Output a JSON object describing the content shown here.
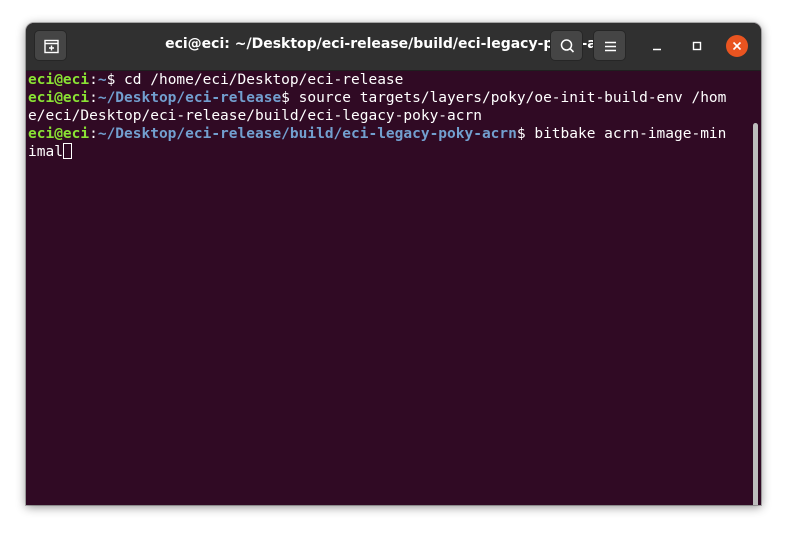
{
  "window": {
    "title": "eci@eci: ~/Desktop/eci-release/build/eci-legacy-poky-acrn"
  },
  "toolbar": {
    "new_tab_icon": "new-tab-icon",
    "search_icon": "search-icon",
    "menu_icon": "hamburger-menu-icon",
    "minimize_icon": "minimize-icon",
    "maximize_icon": "maximize-icon",
    "close_icon": "close-icon"
  },
  "colors": {
    "terminal_bg": "#300a24",
    "prompt_user": "#8ae234",
    "prompt_path": "#729fcf",
    "close_button": "#e95420"
  },
  "terminal": {
    "lines": [
      {
        "user": "eci@eci",
        "sep": ":",
        "path": "~",
        "symbol": "$",
        "command": " cd /home/eci/Desktop/eci-release"
      },
      {
        "user": "eci@eci",
        "sep": ":",
        "path": "~/Desktop/eci-release",
        "symbol": "$",
        "command": " source targets/layers/poky/oe-init-build-env /hom"
      },
      {
        "text": "e/eci/Desktop/eci-release/build/eci-legacy-poky-acrn"
      },
      {
        "user": "eci@eci",
        "sep": ":",
        "path": "~/Desktop/eci-release/build/eci-legacy-poky-acrn",
        "symbol": "$",
        "command": " bitbake acrn-image-min"
      },
      {
        "text": "imal"
      }
    ]
  }
}
